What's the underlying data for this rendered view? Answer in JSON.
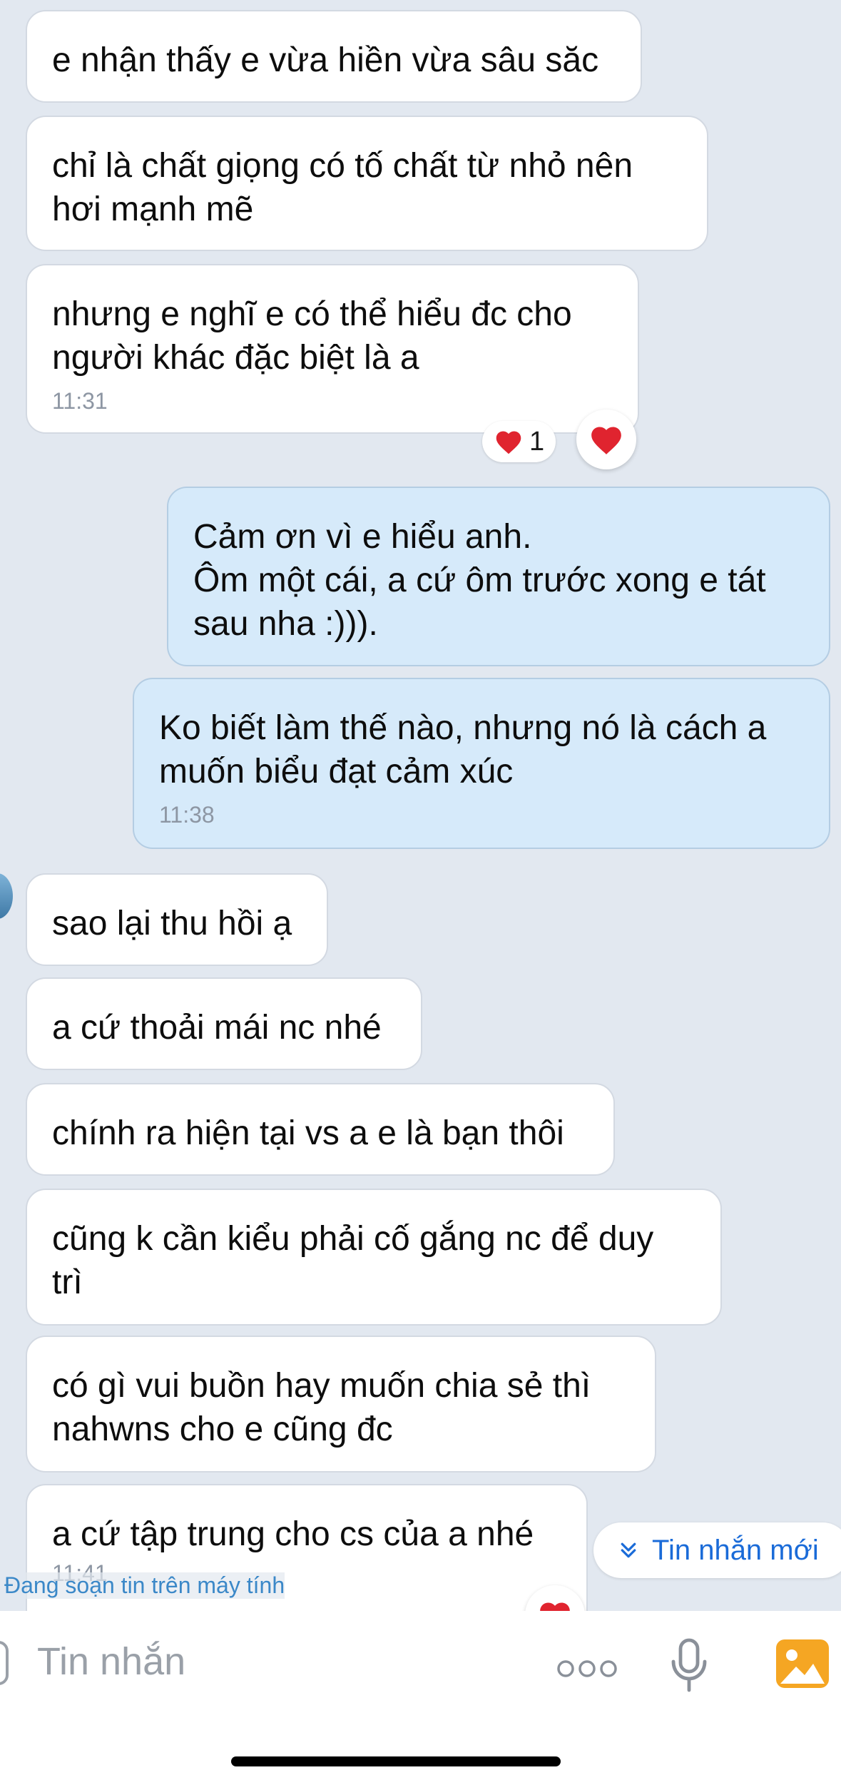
{
  "messages": [
    {
      "id": "m1",
      "side": "in",
      "text": "e nhận thấy e vừa hiền vừa sâu săc"
    },
    {
      "id": "m2",
      "side": "in",
      "text": "chỉ là chất giọng có tố chất từ nhỏ nên\nhơi mạnh mẽ"
    },
    {
      "id": "m3",
      "side": "in",
      "text": "nhưng e nghĩ e có thể hiểu đc cho\nngười khác đặc biệt là a",
      "time": "11:31",
      "reaction_count": "1"
    },
    {
      "id": "m4",
      "side": "out",
      "text": "Cảm ơn vì e hiểu anh.\nÔm một cái, a cứ ôm trước xong e tát\nsau nha :)))."
    },
    {
      "id": "m5",
      "side": "out",
      "text": "Ko biết làm thế nào, nhưng nó là cách a\nmuốn biểu đạt cảm xúc",
      "time": "11:38"
    },
    {
      "id": "m6",
      "side": "in",
      "text": "sao lại thu hồi ạ"
    },
    {
      "id": "m7",
      "side": "in",
      "text": "a cứ thoải mái nc nhé"
    },
    {
      "id": "m8",
      "side": "in",
      "text": "chính ra hiện tại vs a e là bạn thôi"
    },
    {
      "id": "m9",
      "side": "in",
      "text": "cũng k cần kiểu phải cố gắng nc để duy\ntrì"
    },
    {
      "id": "m10",
      "side": "in",
      "text": "có gì vui buồn hay muốn chia sẻ thì\nnahwns cho e cũng đc"
    },
    {
      "id": "m11",
      "side": "in",
      "text": "a cứ tập trung cho cs của a nhé",
      "time": "11:41"
    }
  ],
  "new_messages_label": "Tin nhắn mới",
  "typing_status": "Đang soạn tin trên máy tính",
  "composer": {
    "placeholder": "Tin nhắn"
  },
  "icons": {
    "reaction": "heart-icon",
    "new_messages": "double-chevron-down-icon",
    "more": "more-dots-icon",
    "voice": "microphone-icon",
    "image": "image-gallery-icon"
  },
  "colors": {
    "background": "#e2e8f0",
    "incoming_bubble": "#ffffff",
    "outgoing_bubble": "#d6eafa",
    "accent": "#1a6bd8",
    "heart": "#e0242f",
    "image_icon": "#f5a623"
  }
}
